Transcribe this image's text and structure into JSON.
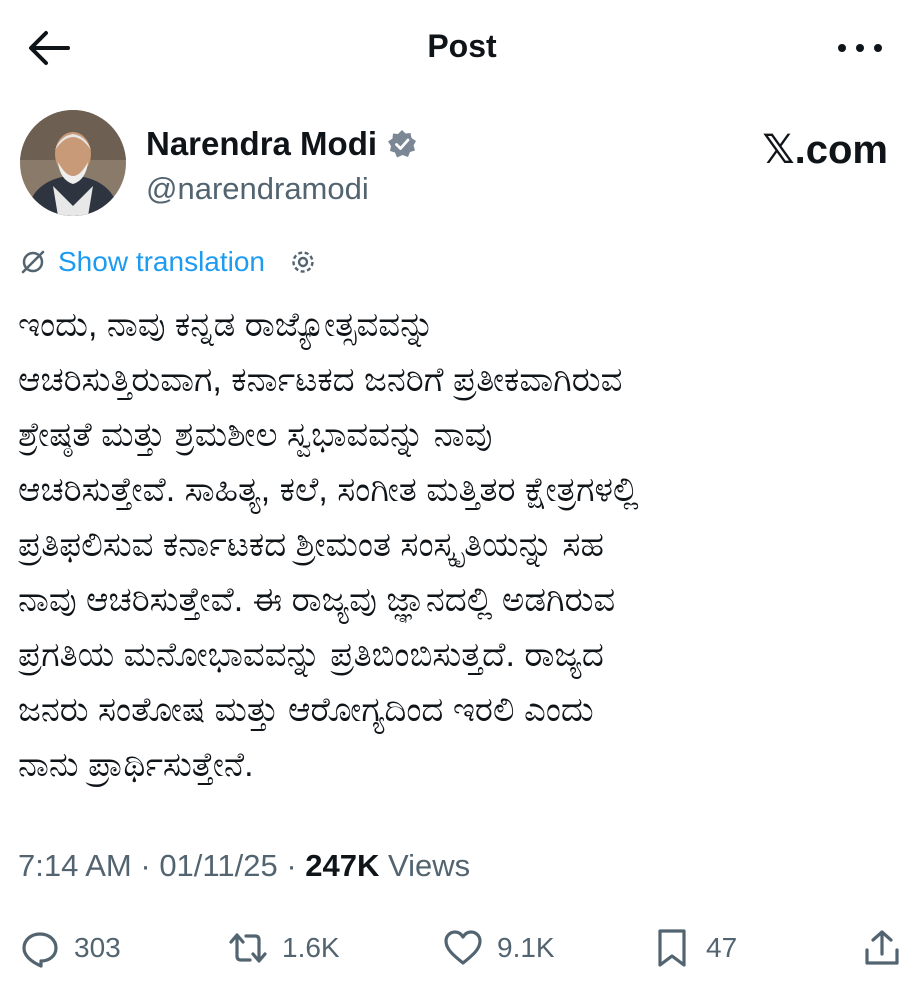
{
  "header": {
    "title": "Post"
  },
  "author": {
    "name": "Narendra Modi",
    "handle": "@narendramodi",
    "brand": "𝕏.com"
  },
  "translation": {
    "label": "Show translation"
  },
  "post": {
    "text": "ಇಂದು, ನಾವು ಕನ್ನಡ ರಾಜ್ಯೋತ್ಸವವನ್ನು\nಆಚರಿಸುತ್ತಿರುವಾಗ, ಕರ್ನಾಟಕದ ಜನರಿಗೆ ಪ್ರತೀಕವಾಗಿರುವ\nಶ್ರೇಷ್ಠತೆ ಮತ್ತು ಶ್ರಮಶೀಲ ಸ್ವಭಾವವನ್ನು ನಾವು\nಆಚರಿಸುತ್ತೇವೆ. ಸಾಹಿತ್ಯ, ಕಲೆ, ಸಂಗೀತ ಮತ್ತಿತರ ಕ್ಷೇತ್ರಗಳಲ್ಲಿ\nಪ್ರತಿಫಲಿಸುವ ಕರ್ನಾಟಕದ ಶ್ರೀಮಂತ ಸಂಸ್ಕೃತಿಯನ್ನು ಸಹ\nನಾವು ಆಚರಿಸುತ್ತೇವೆ. ಈ ರಾಜ್ಯವು ಜ್ಞಾನದಲ್ಲಿ ಅಡಗಿರುವ\nಪ್ರಗತಿಯ ಮನೋಭಾವವನ್ನು ಪ್ರತಿಬಿಂಬಿಸುತ್ತದೆ. ರಾಜ್ಯದ\nಜನರು ಸಂತೋಷ ಮತ್ತು ಆರೋಗ್ಯದಿಂದ ಇರಲಿ ಎಂದು\nನಾನು ಪ್ರಾರ್ಥಿಸುತ್ತೇನೆ."
  },
  "meta": {
    "time": "7:14 AM",
    "date": "01/11/25",
    "views_count": "247K",
    "views_label": "Views"
  },
  "actions": {
    "replies": "303",
    "reposts": "1.6K",
    "likes": "9.1K",
    "bookmarks": "47"
  },
  "colors": {
    "accent": "#1d9bf0",
    "text": "#0f1419",
    "muted": "#536471"
  },
  "icons": [
    "back-arrow-icon",
    "more-icon",
    "verified-badge-icon",
    "translate-icon",
    "gear-icon",
    "reply-icon",
    "repost-icon",
    "like-icon",
    "bookmark-icon",
    "share-icon"
  ]
}
